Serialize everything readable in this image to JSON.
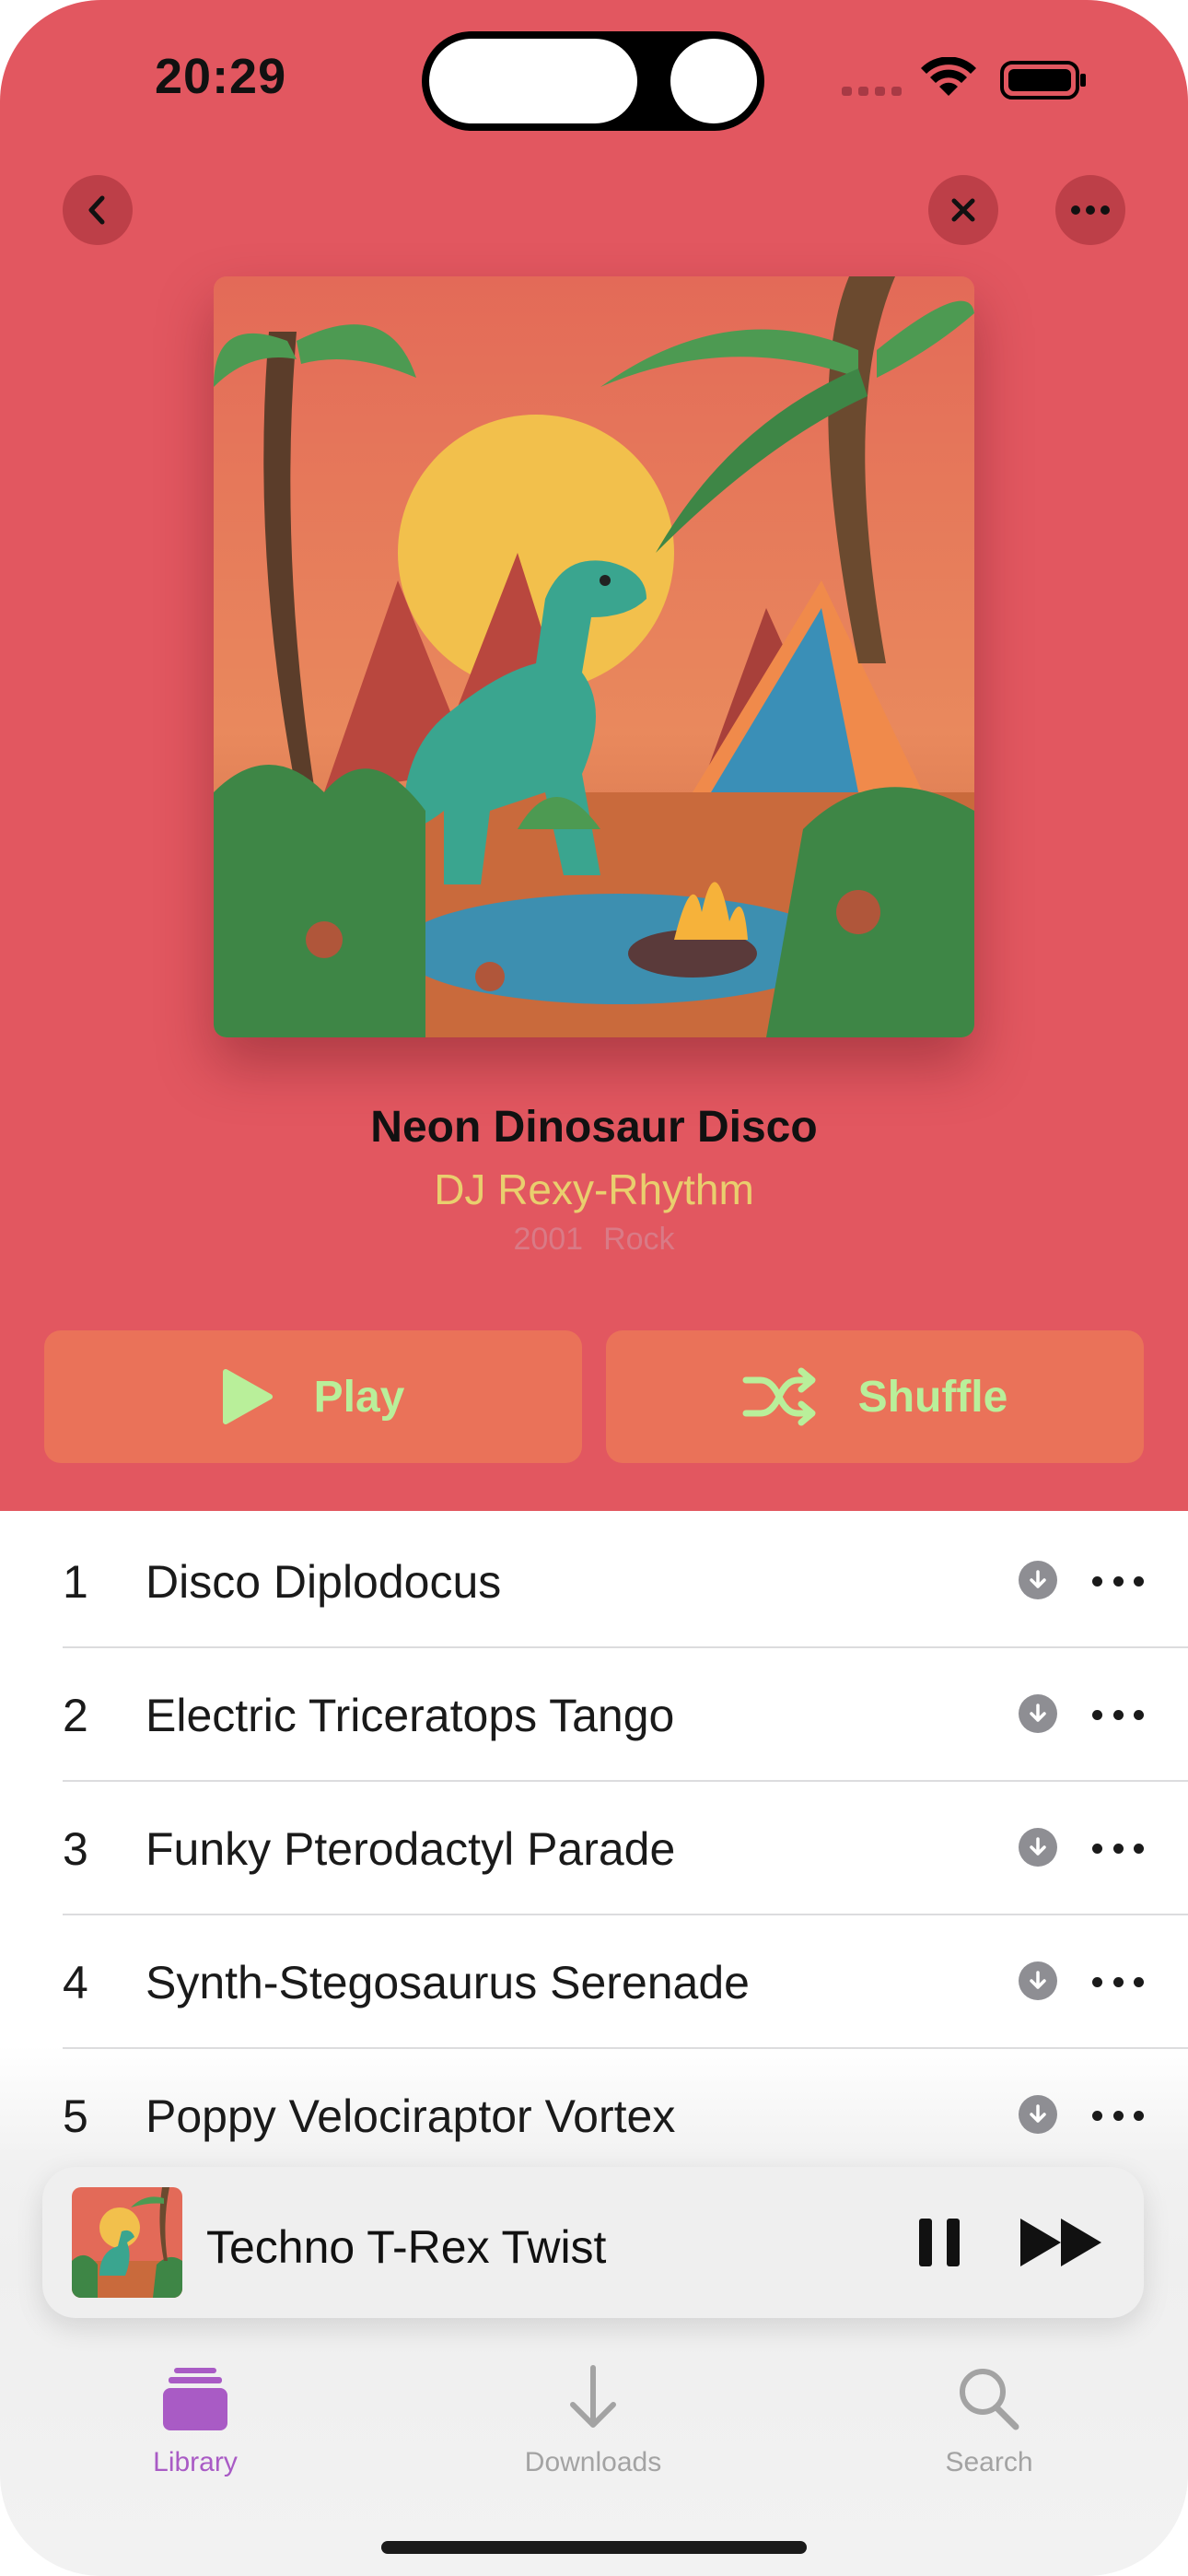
{
  "status_bar": {
    "time": "20:29"
  },
  "nav": {
    "back_icon": "chevron-left-icon",
    "close_icon": "close-icon",
    "more_icon": "ellipsis-icon"
  },
  "album": {
    "title": "Neon Dinosaur Disco",
    "artist": "DJ Rexy-Rhythm",
    "year": "2001",
    "genre": "Rock",
    "artwork": "dinosaur-jungle-artwork"
  },
  "actions": {
    "play_label": "Play",
    "shuffle_label": "Shuffle"
  },
  "tracks": [
    {
      "number": "1",
      "title": "Disco Diplodocus"
    },
    {
      "number": "2",
      "title": "Electric Triceratops Tango"
    },
    {
      "number": "3",
      "title": "Funky Pterodactyl Parade"
    },
    {
      "number": "4",
      "title": "Synth-Stegosaurus Serenade"
    },
    {
      "number": "5",
      "title": "Poppy Velociraptor Vortex"
    }
  ],
  "mini_player": {
    "now_playing": "Techno T-Rex Twist",
    "state": "playing"
  },
  "tab_bar": {
    "items": [
      {
        "label": "Library",
        "icon": "library-icon",
        "active": true
      },
      {
        "label": "Downloads",
        "icon": "download-arrow-icon",
        "active": false
      },
      {
        "label": "Search",
        "icon": "magnifier-icon",
        "active": false
      }
    ]
  },
  "colors": {
    "hero_background": "#e25760",
    "action_button": "#ea7259",
    "action_text": "#b9ef9a",
    "artist_text": "#e9cf6e",
    "accent_purple": "#a95bc5"
  }
}
